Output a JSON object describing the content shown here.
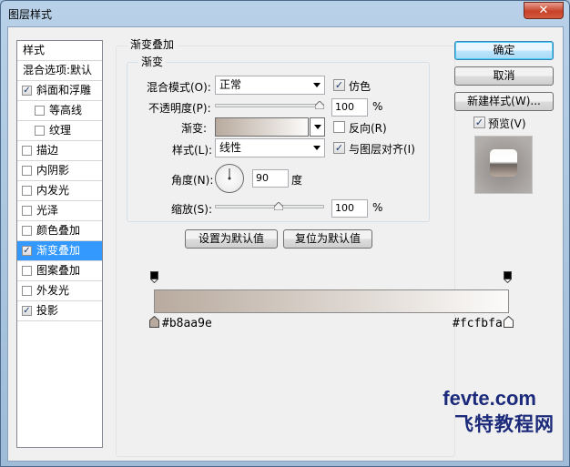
{
  "window": {
    "title": "图层样式",
    "close_glyph": "✕"
  },
  "style_list": {
    "header": "样式",
    "blend_options": "混合选项:默认",
    "items": [
      {
        "label": "斜面和浮雕",
        "checked": true
      },
      {
        "label": "等高线",
        "checked": false,
        "indent": true
      },
      {
        "label": "纹理",
        "checked": false,
        "indent": true
      },
      {
        "label": "描边",
        "checked": false
      },
      {
        "label": "内阴影",
        "checked": false
      },
      {
        "label": "内发光",
        "checked": false
      },
      {
        "label": "光泽",
        "checked": false
      },
      {
        "label": "颜色叠加",
        "checked": false
      },
      {
        "label": "渐变叠加",
        "checked": true,
        "selected": true
      },
      {
        "label": "图案叠加",
        "checked": false
      },
      {
        "label": "外发光",
        "checked": false
      },
      {
        "label": "投影",
        "checked": true
      }
    ]
  },
  "panel": {
    "group_title": "渐变叠加",
    "subgroup_title": "渐变",
    "blend_mode": {
      "label": "混合模式(O):",
      "value": "正常"
    },
    "dither": {
      "label": "仿色",
      "checked": true
    },
    "opacity": {
      "label": "不透明度(P):",
      "value": "100",
      "unit": "%"
    },
    "gradient": {
      "label": "渐变:",
      "colors": [
        "#b8aa9e",
        "#fcfbfa"
      ]
    },
    "reverse": {
      "label": "反向(R)",
      "checked": false
    },
    "style": {
      "label": "样式(L):",
      "value": "线性"
    },
    "align": {
      "label": "与图层对齐(I)",
      "checked": true
    },
    "angle": {
      "label": "角度(N):",
      "value": "90",
      "unit": "度"
    },
    "scale": {
      "label": "缩放(S):",
      "value": "100",
      "unit": "%"
    },
    "set_default": "设置为默认值",
    "reset_default": "复位为默认值"
  },
  "gradient_editor": {
    "left_color": "#b8aa9e",
    "right_color": "#fcfbfa",
    "left_label": "#b8aa9e",
    "right_label": "#fcfbfa"
  },
  "buttons": {
    "ok": "确定",
    "cancel": "取消",
    "new_style": "新建样式(W)...",
    "preview": {
      "label": "预览(V)",
      "checked": true
    }
  },
  "watermark": {
    "line1": "fevte.com",
    "line2": "飞特教程网"
  },
  "check_glyph": "✓"
}
